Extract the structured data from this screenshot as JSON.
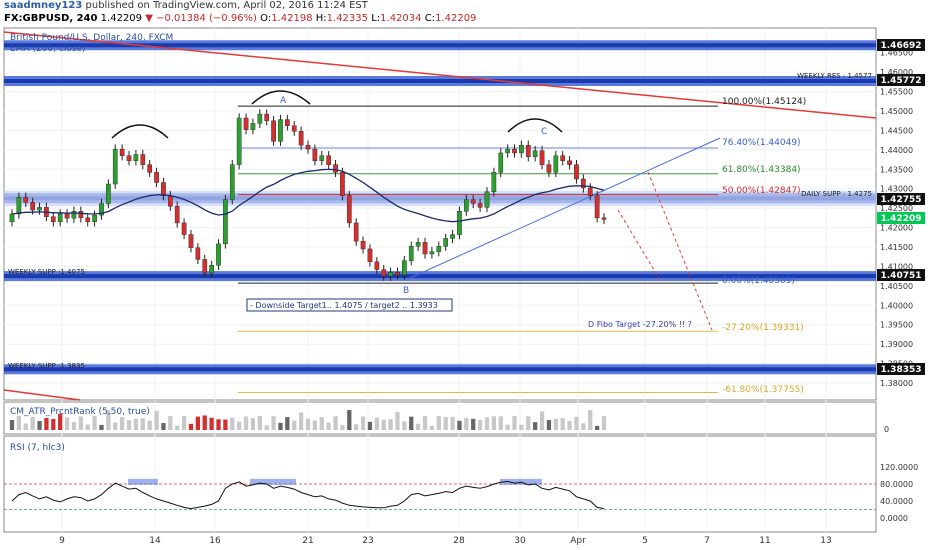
{
  "header": {
    "author": "saadmney123",
    "published": "published on TradingView.com, April 02, 2016 11:24 EST",
    "symbol": "FX:GBPUSD, 240",
    "last": "1.42209",
    "change": "▼ −0.01384 (−0.96%)",
    "open_label": "O:",
    "open": "1.42198",
    "high_label": "H:",
    "high": "1.42335",
    "low_label": "L:",
    "low": "1.42034",
    "close_label": "C:",
    "close": "1.42209"
  },
  "legend": {
    "pair": "British Pound/U.S. Dollar, 240, FXCM",
    "ema": "EMA (200, close)",
    "atr": "CM_ATR_PrcntRank (5,50, true)",
    "rsi": "RSI (7, hlc3)"
  },
  "annotations": {
    "weekly_res": "WEEKLY RES : 1.4577",
    "daily_supp": "DAILY SUPP : 1.4275",
    "weekly_supp1": "WEEKLY SUPP :1.4075",
    "weekly_supp2": "WEEKLY SUPP :1.3835",
    "fib100": "100.00%(1.45124)",
    "fib764": "76.40%(1.44049)",
    "fib618": "61.80%(1.43384)",
    "fib50": "50.00%(1.42847)",
    "fib0": "0.00%(1.40569)",
    "fib_m272": "-27.20%(1.39331)",
    "fib_m618": "-61.80%(1.37755)",
    "targets": "- Downside Target1.. 1.4075 / target2 .. 1.3933",
    "d_fibo": "D Fibo Target -27.20% !! ?",
    "A": "A",
    "B": "B",
    "C": "C"
  },
  "price_boxes": {
    "b1": "1.46692",
    "b2": "1.45772",
    "b3": "1.42755",
    "b4": "1.42209",
    "b5": "1.40751",
    "b6": "1.38353"
  },
  "chart_data": {
    "type": "candlestick",
    "symbol": "FX:GBPUSD",
    "timeframe": "240",
    "x_ticks": [
      "9",
      "14",
      "16",
      "21",
      "23",
      "28",
      "30",
      "Apr",
      "5",
      "7",
      "11",
      "13"
    ],
    "y_ticks": [
      1.465,
      1.46,
      1.455,
      1.45,
      1.445,
      1.44,
      1.435,
      1.43,
      1.425,
      1.42,
      1.415,
      1.41,
      1.405,
      1.4,
      1.395,
      1.39,
      1.385,
      1.38
    ],
    "y_tick_labels": [
      "1.46500",
      "1.46000",
      "1.45500",
      "1.45000",
      "1.44500",
      "1.44000",
      "1.43500",
      "1.43000",
      "1.42500",
      "1.42000",
      "1.41500",
      "1.41000",
      "1.40500",
      "1.40000",
      "1.39500",
      "1.39000",
      "1.38500",
      "1.38000"
    ],
    "ylim": [
      1.374,
      1.468
    ],
    "closes": [
      1.4235,
      1.4278,
      1.4265,
      1.4245,
      1.4252,
      1.4228,
      1.4215,
      1.4235,
      1.4224,
      1.4242,
      1.4225,
      1.4215,
      1.4232,
      1.4262,
      1.4312,
      1.4402,
      1.4385,
      1.4372,
      1.4388,
      1.4362,
      1.4342,
      1.4316,
      1.4282,
      1.4255,
      1.4212,
      1.4182,
      1.4148,
      1.4118,
      1.4083,
      1.4103,
      1.4158,
      1.4272,
      1.4362,
      1.4482,
      1.4452,
      1.4468,
      1.4492,
      1.4475,
      1.4422,
      1.4478,
      1.4462,
      1.4448,
      1.4412,
      1.4402,
      1.4372,
      1.4385,
      1.4362,
      1.4342,
      1.4282,
      1.4212,
      1.4165,
      1.4145,
      1.4112,
      1.4092,
      1.4075,
      1.4085,
      1.4078,
      1.4115,
      1.4152,
      1.4162,
      1.4132,
      1.4138,
      1.4152,
      1.4172,
      1.4182,
      1.4242,
      1.4272,
      1.4262,
      1.4252,
      1.4292,
      1.4342,
      1.4392,
      1.4402,
      1.4392,
      1.4412,
      1.4382,
      1.4398,
      1.4362,
      1.4342,
      1.4385,
      1.4372,
      1.4362,
      1.4325,
      1.4302,
      1.4282,
      1.4225,
      1.4221
    ],
    "ema200_label": "EMA (200, close)",
    "levels": [
      1.46692,
      1.45772,
      1.42755,
      1.40751,
      1.38353
    ],
    "fib_levels": [
      1.45124,
      1.44049,
      1.43384,
      1.42847,
      1.40569,
      1.39331,
      1.37755
    ],
    "atr_pane": {
      "label": "CM_ATR_PrcntRank (5,50, true)",
      "y_ticks": [
        0
      ]
    },
    "rsi_pane": {
      "label": "RSI (7, hlc3)",
      "y_ticks": [
        120,
        80,
        40,
        0
      ],
      "y_tick_labels": [
        "120.0000",
        "80.0000",
        "40.0000",
        "0.0000"
      ],
      "overbought": 80,
      "oversold": 20,
      "values": [
        40,
        55,
        60,
        52,
        45,
        50,
        42,
        38,
        45,
        50,
        48,
        40,
        45,
        55,
        70,
        82,
        75,
        68,
        70,
        60,
        52,
        45,
        40,
        35,
        30,
        25,
        22,
        25,
        28,
        32,
        40,
        70,
        80,
        85,
        75,
        78,
        82,
        80,
        70,
        75,
        72,
        68,
        60,
        55,
        50,
        52,
        45,
        42,
        35,
        30,
        28,
        26,
        25,
        24,
        24,
        28,
        30,
        40,
        55,
        58,
        52,
        55,
        58,
        62,
        60,
        70,
        75,
        72,
        70,
        74,
        80,
        84,
        86,
        82,
        84,
        78,
        80,
        70,
        66,
        72,
        68,
        64,
        50,
        45,
        40,
        25,
        22
      ]
    }
  }
}
